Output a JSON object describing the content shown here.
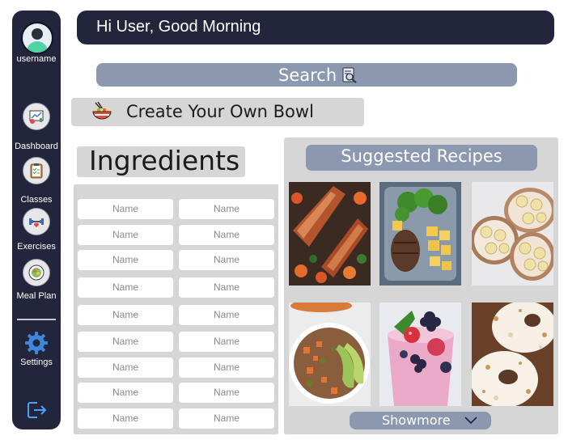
{
  "sidebar": {
    "username": "username",
    "items": [
      {
        "label": "Dashboard",
        "icon": "dashboard-icon"
      },
      {
        "label": "Classes",
        "icon": "clipboard-icon"
      },
      {
        "label": "Exercises",
        "icon": "dumbbell-icon"
      },
      {
        "label": "Meal Plan",
        "icon": "meal-plate-icon"
      }
    ],
    "settings_label": "Settings"
  },
  "header": {
    "greeting": "Hi User, Good Morning"
  },
  "search": {
    "label": "Search"
  },
  "create": {
    "label": "Create Your Own Bowl"
  },
  "ingredients": {
    "title": "Ingredients",
    "fields": [
      "Name",
      "Name",
      "Name",
      "Name",
      "Name",
      "Name",
      "Name",
      "Name",
      "Name",
      "Name",
      "Name",
      "Name",
      "Name",
      "Name",
      "Name",
      "Name",
      "Name",
      "Name"
    ]
  },
  "recipes": {
    "title": "Suggested Recipes",
    "items": [
      "salmon-vegetables",
      "steak-broccoli-potatoes",
      "banana-toast",
      "quinoa-avocado-bowl",
      "berry-smoothie",
      "bagel-pastry"
    ],
    "showmore": "Showmore"
  },
  "colors": {
    "navy": "#22253b",
    "slate": "#8c97b0",
    "panel_gray": "#d6d6d6"
  }
}
